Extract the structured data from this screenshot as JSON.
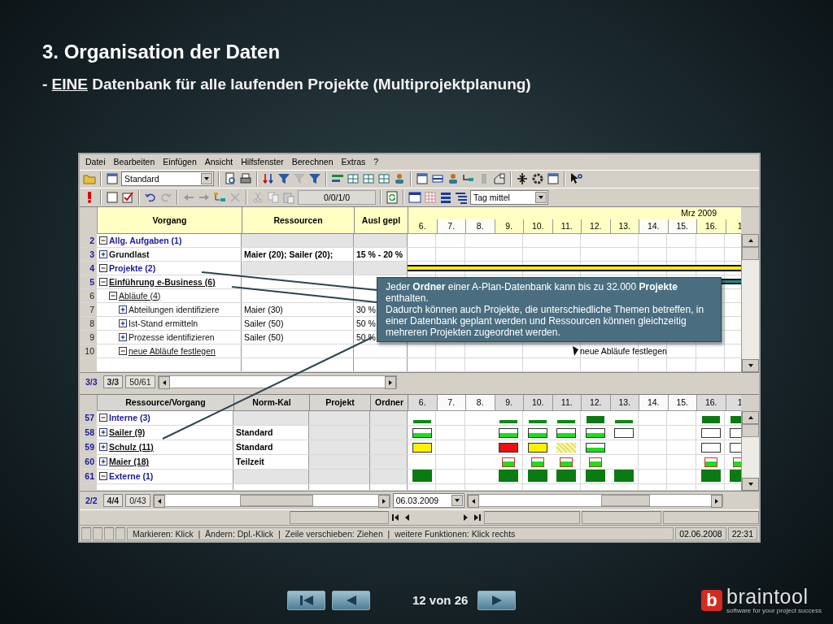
{
  "slide": {
    "title": "3. Organisation der Daten",
    "subtitle": [
      {
        "text": "-",
        "underlined": false
      },
      {
        "text": "EINE",
        "underlined": true
      },
      {
        "text": "Datenbank für alle laufenden Projekte (Multiprojektplanung)",
        "underlined": false
      }
    ]
  },
  "menu": [
    "Datei",
    "Bearbeiten",
    "Einfügen",
    "Ansicht",
    "Hilfsfenster",
    "Berechnen",
    "Extras",
    "?"
  ],
  "toolbar": {
    "view_select": "Standard",
    "position_field": "0/0/1/0",
    "scale_select": "Tag mittel"
  },
  "task_table": {
    "columns": [
      "Vorgang",
      "Ressourcen",
      "Ausl gepl"
    ],
    "month": "Mrz 2009",
    "days": [
      {
        "label": "6.",
        "weekend": false
      },
      {
        "label": "7.",
        "weekend": true
      },
      {
        "label": "8.",
        "weekend": true
      },
      {
        "label": "9.",
        "weekend": false
      },
      {
        "label": "10.",
        "weekend": false
      },
      {
        "label": "11.",
        "weekend": false
      },
      {
        "label": "12.",
        "weekend": false
      },
      {
        "label": "13.",
        "weekend": false
      },
      {
        "label": "14.",
        "weekend": true
      },
      {
        "label": "15.",
        "weekend": true
      },
      {
        "label": "16.",
        "weekend": false
      },
      {
        "label": "1",
        "weekend": false
      }
    ],
    "rows": [
      {
        "number": "2",
        "label": "Allg. Aufgaben (1)",
        "kind": "folder",
        "expanded": true,
        "children": [
          {
            "number": "3",
            "label": "Grundlast",
            "kind": "summary",
            "expanded": false,
            "resources": "Maier (20); Sailer (20);",
            "load": "15 % - 20 %"
          }
        ]
      },
      {
        "number": "4",
        "label": "Projekte (2)",
        "kind": "folder",
        "expanded": true,
        "gantt": {
          "kind": "summary"
        },
        "children": [
          {
            "number": "5",
            "label": "Einführung e-Business (6)",
            "kind": "project",
            "expanded": true,
            "gantt": {
              "kind": "project"
            },
            "children": [
              {
                "number": "6",
                "label": "Abläufe (4)",
                "kind": "group",
                "expanded": true,
                "children": [
                  {
                    "number": "7",
                    "label": "Abteilungen identifiziere",
                    "kind": "task",
                    "expanded": false,
                    "resources": "Maier (30)",
                    "load": "30 %"
                  },
                  {
                    "number": "8",
                    "label": "Ist-Stand ermitteln",
                    "kind": "task",
                    "expanded": false,
                    "resources": "Sailer (50)",
                    "load": "50 %"
                  },
                  {
                    "number": "9",
                    "label": "Prozesse identifizieren",
                    "kind": "task",
                    "expanded": false,
                    "resources": "Sailer (50)",
                    "load": "50 %"
                  },
                  {
                    "number": "10",
                    "label": "neue Abläufe festlegen",
                    "kind": "group",
                    "expanded": true,
                    "gantt": {
                      "kind": "milestone",
                      "label": "neue Abläufe festlegen"
                    }
                  }
                ]
              }
            ]
          }
        ]
      }
    ],
    "counters": [
      "3/3",
      "3/3",
      "50/61"
    ]
  },
  "resource_table": {
    "columns": [
      "Ressource/Vorgang",
      "Norm-Kal",
      "Projekt",
      "Ordner"
    ],
    "days": [
      {
        "label": "6.",
        "weekend": false
      },
      {
        "label": "7.",
        "weekend": true
      },
      {
        "label": "8.",
        "weekend": true
      },
      {
        "label": "9.",
        "weekend": false
      },
      {
        "label": "10.",
        "weekend": false
      },
      {
        "label": "11.",
        "weekend": false
      },
      {
        "label": "12.",
        "weekend": false
      },
      {
        "label": "13.",
        "weekend": false
      },
      {
        "label": "14.",
        "weekend": true
      },
      {
        "label": "15.",
        "weekend": true
      },
      {
        "label": "16.",
        "weekend": false
      },
      {
        "label": "1",
        "weekend": false
      }
    ],
    "rows": [
      {
        "number": "57",
        "label": "Interne (3)",
        "kind": "folder",
        "expanded": true,
        "cells": [
          {
            "kind": "peak"
          },
          {
            "kind": "none"
          },
          {
            "kind": "none"
          },
          {
            "kind": "peak"
          },
          {
            "kind": "peak"
          },
          {
            "kind": "peak"
          },
          {
            "kind": "tall"
          },
          {
            "kind": "peak"
          },
          {
            "kind": "none"
          },
          {
            "kind": "none"
          },
          {
            "kind": "tall"
          },
          {
            "kind": "tall"
          }
        ]
      },
      {
        "number": "58",
        "label": "Sailer (9)",
        "kind": "resource",
        "expanded": false,
        "calendar": "Standard",
        "cells": [
          {
            "kind": "ok"
          },
          {
            "kind": "none"
          },
          {
            "kind": "none"
          },
          {
            "kind": "ok"
          },
          {
            "kind": "ok"
          },
          {
            "kind": "ok"
          },
          {
            "kind": "ok"
          },
          {
            "kind": "empty"
          },
          {
            "kind": "none"
          },
          {
            "kind": "none"
          },
          {
            "kind": "empty"
          },
          {
            "kind": "empty"
          }
        ]
      },
      {
        "number": "59",
        "label": "Schulz (11)",
        "kind": "resource",
        "expanded": false,
        "calendar": "Standard",
        "cells": [
          {
            "kind": "yellow"
          },
          {
            "kind": "none"
          },
          {
            "kind": "none"
          },
          {
            "kind": "over"
          },
          {
            "kind": "yellow"
          },
          {
            "kind": "hatched"
          },
          {
            "kind": "ok"
          },
          {
            "kind": "none"
          },
          {
            "kind": "none"
          },
          {
            "kind": "none"
          },
          {
            "kind": "empty"
          },
          {
            "kind": "empty"
          }
        ]
      },
      {
        "number": "60",
        "label": "Maier (18)",
        "kind": "resource",
        "expanded": false,
        "calendar": "Teilzeit",
        "cells": [
          {
            "kind": "none"
          },
          {
            "kind": "none"
          },
          {
            "kind": "none"
          },
          {
            "kind": "part"
          },
          {
            "kind": "part"
          },
          {
            "kind": "part"
          },
          {
            "kind": "part"
          },
          {
            "kind": "none"
          },
          {
            "kind": "none"
          },
          {
            "kind": "none"
          },
          {
            "kind": "part"
          },
          {
            "kind": "part"
          }
        ]
      },
      {
        "number": "61",
        "label": "Externe (1)",
        "kind": "folder",
        "expanded": true,
        "cells": [
          {
            "kind": "solid"
          },
          {
            "kind": "none"
          },
          {
            "kind": "none"
          },
          {
            "kind": "solid"
          },
          {
            "kind": "solid"
          },
          {
            "kind": "solid"
          },
          {
            "kind": "solid"
          },
          {
            "kind": "solid"
          },
          {
            "kind": "none"
          },
          {
            "kind": "none"
          },
          {
            "kind": "solid"
          },
          {
            "kind": "solid"
          }
        ]
      }
    ],
    "counters": [
      "2/2",
      "4/4",
      "0/43"
    ],
    "date_select": "06.03.2009"
  },
  "status_bar": {
    "hint": "Markieren: Klick  |  Ändern: Dpl.-Klick  |  Zeile verschieben: Ziehen  |  weitere Funktionen: Klick rechts",
    "date": "02.06.2008",
    "time": "22:31"
  },
  "callout": {
    "paragraphs": [
      "Jeder **Ordner** einer A-Plan-Datenbank kann bis zu 32.000 **Projekte** enthalten.",
      "Dadurch können auch Projekte, die unterschiedliche Themen betreffen, in einer Datenbank geplant werden und Ressourcen können gleichzeitig mehreren Projekten zugeordnet werden."
    ]
  },
  "footer": {
    "page": "12 von 26",
    "logo_mark": "b",
    "logo_name": "braintool",
    "logo_tagline": "software for your project success"
  }
}
